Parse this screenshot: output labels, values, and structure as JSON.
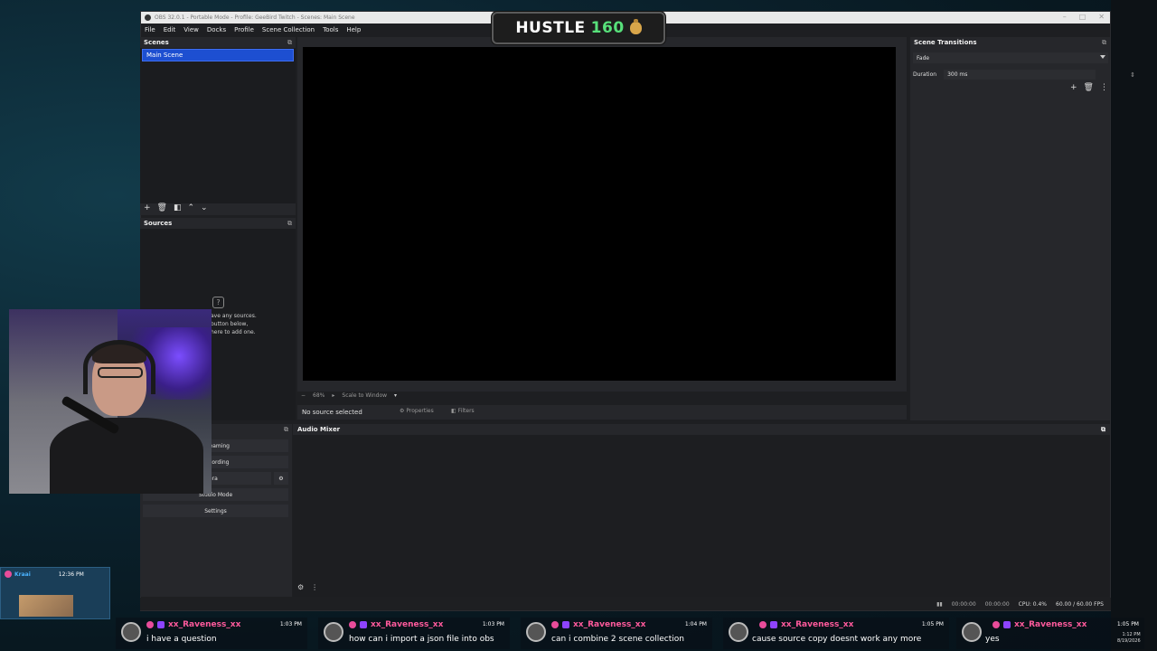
{
  "window": {
    "title": "OBS 32.0.1 - Portable Mode - Profile: GeeBird Twitch - Scenes: Main Scene",
    "controls": [
      "–",
      "□",
      "✕"
    ]
  },
  "menu": [
    "File",
    "Edit",
    "View",
    "Docks",
    "Profile",
    "Scene Collection",
    "Tools",
    "Help"
  ],
  "overlay": {
    "hustle_label": "HUSTLE",
    "hustle_number": "160"
  },
  "scenes": {
    "title": "Scenes",
    "items": [
      "Main Scene"
    ]
  },
  "sources": {
    "title": "Sources",
    "empty_line1": "ave any sources.",
    "empty_line2": "button below,",
    "empty_line3": "here to add one."
  },
  "preview": {
    "zoom": "68%",
    "scale_label": "Scale to Window"
  },
  "context_bar": {
    "no_selection": "No source selected",
    "properties": "Properties",
    "filters": "Filters"
  },
  "transitions": {
    "title": "Scene Transitions",
    "selected": "Fade",
    "duration_label": "Duration",
    "duration_value": "300 ms"
  },
  "audio_mixer": {
    "title": "Audio Mixer"
  },
  "controls": {
    "start_streaming": "Streaming",
    "start_recording": "Recording",
    "virtual_camera": "Camera",
    "studio_mode": "Studio Mode",
    "settings": "Settings"
  },
  "status": {
    "time1": "00:00:00",
    "time2": "00:00:00",
    "cpu": "CPU: 0.4%",
    "fps": "60.00 / 60.00 FPS"
  },
  "chat": {
    "top_user": "Kraai",
    "top_time": "12:36 PM",
    "messages": [
      {
        "user": "xx_Raveness_xx",
        "time": "1:03 PM",
        "text": "i have a question"
      },
      {
        "user": "xx_Raveness_xx",
        "time": "1:03 PM",
        "text": "how can i import a json file into obs"
      },
      {
        "user": "xx_Raveness_xx",
        "time": "1:04 PM",
        "text": "can i combine 2 scene collection"
      },
      {
        "user": "xx_Raveness_xx",
        "time": "1:05 PM",
        "text": "cause source copy doesnt work any more"
      },
      {
        "user": "xx_Raveness_xx",
        "time": "1:05 PM",
        "text": "yes"
      }
    ]
  },
  "clock": {
    "time": "1:12 PM",
    "date": "8/19/2026"
  },
  "colors": {
    "accent": "#1d4fd1",
    "panel": "#26272b",
    "chat_name": "#ff5a9c",
    "hustle_number": "#57e07a"
  }
}
